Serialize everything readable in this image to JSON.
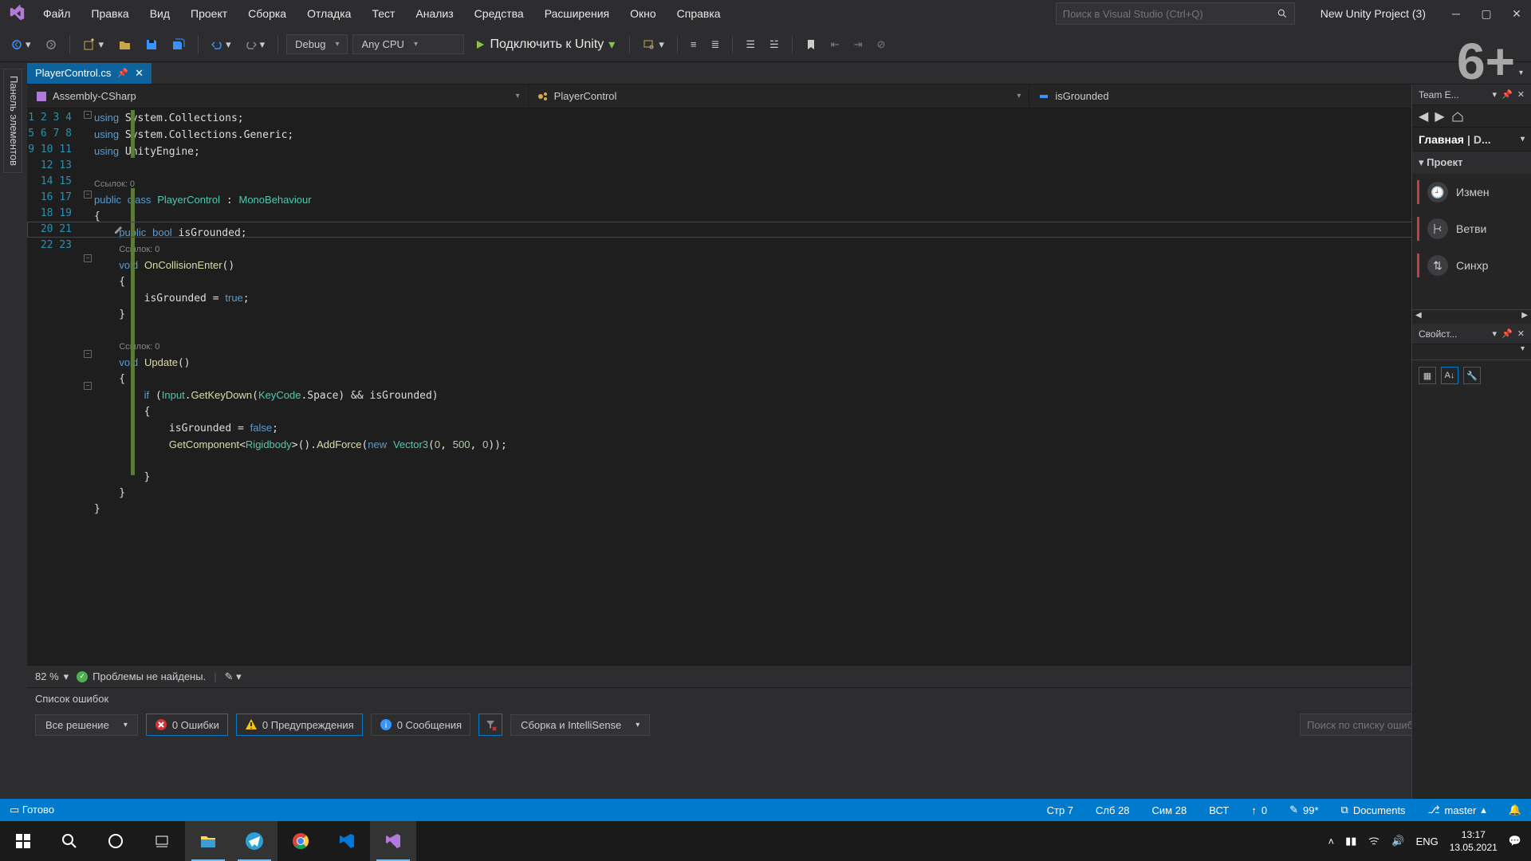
{
  "menu": [
    "Файл",
    "Правка",
    "Вид",
    "Проект",
    "Сборка",
    "Отладка",
    "Тест",
    "Анализ",
    "Средства",
    "Расширения",
    "Окно",
    "Справка"
  ],
  "search_placeholder": "Поиск в Visual Studio (Ctrl+Q)",
  "project": "New Unity Project (3)",
  "toolbar": {
    "config": "Debug",
    "platform": "Any CPU",
    "attach": "Подключить к Unity"
  },
  "vtab": "Панель элементов",
  "tab": {
    "file": "PlayerControl.cs"
  },
  "nav": {
    "asm": "Assembly-CSharp",
    "class": "PlayerControl",
    "member": "isGrounded"
  },
  "refs": "Ссылок: 0",
  "zoom": "82 %",
  "noproblems": "Проблемы не найдены.",
  "errlist": {
    "title": "Список ошибок",
    "scope": "Все решение",
    "errors": "0 Ошибки",
    "warnings": "0 Предупреждения",
    "messages": "0 Сообщения",
    "filter": "Сборка и IntelliSense",
    "search_placeholder": "Поиск по списку ошибок"
  },
  "status": {
    "ready": "Готово",
    "line": "Стр 7",
    "col": "Слб 28",
    "sym": "Сим 28",
    "ins": "ВСТ",
    "up": "0",
    "changes": "99*",
    "repo": "Documents",
    "branch": "master"
  },
  "team": {
    "title": "Team E...",
    "tab1": "Главная",
    "tab2": "D...",
    "section": "Проект",
    "items": [
      "Измен",
      "Ветви",
      "Синхр"
    ]
  },
  "props": {
    "title": "Свойст..."
  },
  "tray": {
    "lang": "ENG",
    "time": "13:17",
    "date": "13.05.2021"
  },
  "age": "6+"
}
